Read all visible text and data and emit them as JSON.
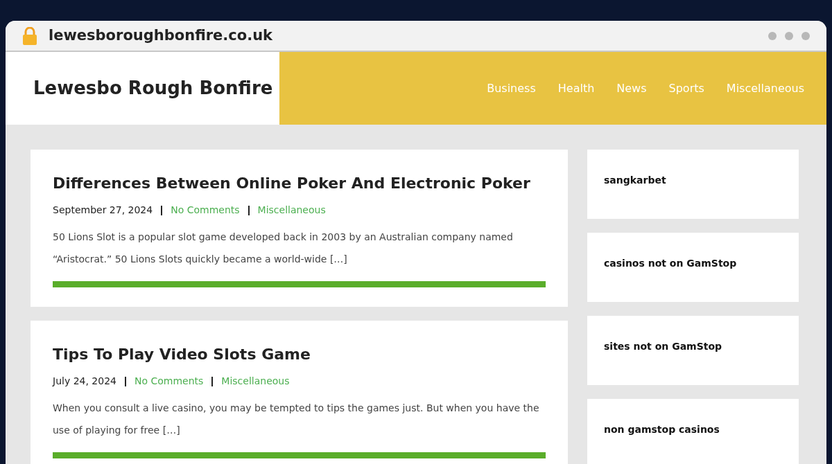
{
  "browser": {
    "url": "lewesboroughbonfire.co.uk"
  },
  "site": {
    "title": "Lewesbo Rough Bonfire",
    "nav": [
      "Business",
      "Health",
      "News",
      "Sports",
      "Miscellaneous"
    ]
  },
  "posts": [
    {
      "title": "Differences Between Online Poker And Electronic Poker",
      "date": "September 27, 2024",
      "comments": "No Comments",
      "category": "Miscellaneous",
      "excerpt": "50 Lions Slot is a popular slot game developed back in 2003 by an Australian company named “Aristocrat.” 50 Lions Slots quickly became a world-wide […]"
    },
    {
      "title": "Tips To Play Video Slots Game",
      "date": "July 24, 2024",
      "comments": "No Comments",
      "category": "Miscellaneous",
      "excerpt": "When you consult a live casino, you may be tempted to tips the games just. But when you have the use of playing for free […]"
    }
  ],
  "sidebar": [
    "sangkarbet",
    "casinos not on GamStop",
    "sites not on GamStop",
    "non gamstop casinos"
  ]
}
